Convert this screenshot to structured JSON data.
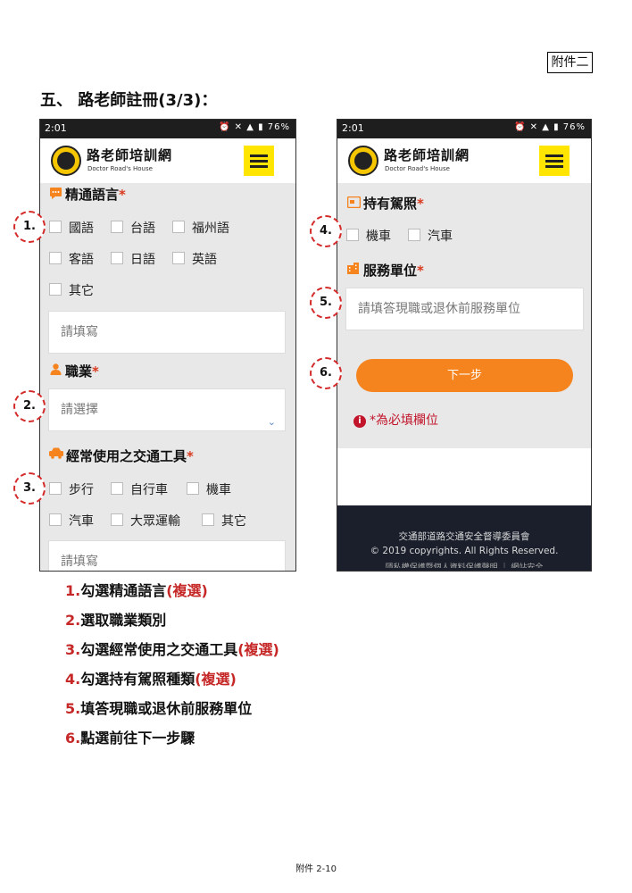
{
  "doc": {
    "attachment_label": "附件二",
    "section_heading": "五、 路老師註冊(3/3)：",
    "page_footer": "附件 2-10"
  },
  "phone": {
    "time": "2:01",
    "battery": "76%",
    "logo_badge": "路老師",
    "logo_title": "路老師培訓網",
    "logo_subtitle": "Doctor Road's House"
  },
  "form_left": {
    "language": {
      "label": "精通語言",
      "required": "*",
      "options": [
        "國語",
        "台語",
        "福州語",
        "客語",
        "日語",
        "英語",
        "其它"
      ],
      "other_placeholder": "請填寫"
    },
    "occupation": {
      "label": "職業",
      "required": "*",
      "select_value": "請選擇"
    },
    "transport": {
      "label": "經常使用之交通工具",
      "required": "*",
      "options": [
        "步行",
        "自行車",
        "機車",
        "汽車",
        "大眾運輸",
        "其它"
      ],
      "other_placeholder": "請填寫"
    }
  },
  "form_right": {
    "license": {
      "label": "持有駕照",
      "required": "*",
      "options": [
        "機車",
        "汽車"
      ]
    },
    "service_unit": {
      "label": "服務單位",
      "required": "*",
      "placeholder": "請填答現職或退休前服務單位"
    },
    "next_button": "下一步",
    "required_note": "*為必填欄位",
    "info_glyph": "i",
    "footer_line1": "交通部道路交通安全督導委員會",
    "footer_line2": "© 2019 copyrights. All Rights Reserved.",
    "footer_line3": "隱私權保護暨個人資料保護聲明 ｜ 網站安全"
  },
  "markers": [
    "1.",
    "2.",
    "3.",
    "4.",
    "5.",
    "6."
  ],
  "steps": [
    {
      "num": "1.",
      "text": "勾選精通語言",
      "multi": "(複選)"
    },
    {
      "num": "2.",
      "text": "選取職業類別",
      "multi": ""
    },
    {
      "num": "3.",
      "text": "勾選經常使用之交通工具",
      "multi": "(複選)"
    },
    {
      "num": "4.",
      "text": "勾選持有駕照種類",
      "multi": "(複選)"
    },
    {
      "num": "5.",
      "text": "填答現職或退休前服務單位",
      "multi": ""
    },
    {
      "num": "6.",
      "text": "點選前往下一步驟",
      "multi": ""
    }
  ],
  "colors": {
    "accent_orange": "#f5841f",
    "required_red": "#d93a1e",
    "menu_yellow": "#ffe500",
    "step_red": "#c62828",
    "footer_bg": "#1a1f2b"
  },
  "icons": [
    "chat-icon",
    "person-icon",
    "car-icon",
    "license-icon",
    "building-icon",
    "info-icon",
    "menu-icon",
    "chevron-down-icon"
  ]
}
